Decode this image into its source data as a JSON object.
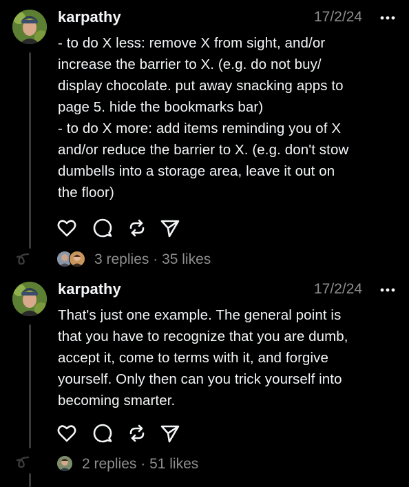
{
  "posts": [
    {
      "username": "karpathy",
      "date": "17/2/24",
      "lines": [
        "- to do X less: remove X from sight, and/or",
        "increase the barrier to X. (e.g. do not buy/",
        "display chocolate. put away snacking apps to",
        "page 5. hide the bookmarks bar)",
        "- to do X more: add items reminding you of X",
        "and/or reduce the barrier to X. (e.g. don't stow",
        "dumbells into a storage area, leave it out on",
        "the floor)"
      ],
      "replies": "3 replies",
      "separator": "·",
      "likes": "35 likes"
    },
    {
      "username": "karpathy",
      "date": "17/2/24",
      "lines": [
        "That's just one example. The general point is",
        "that you have to recognize that you are dumb,",
        "accept it, come to terms with it, and forgive",
        "yourself. Only then can you trick yourself into",
        "becoming smarter."
      ],
      "replies": "2 replies",
      "separator": "·",
      "likes": "51 likes"
    }
  ],
  "icons": [
    "heart-icon",
    "comment-icon",
    "repost-icon",
    "share-icon",
    "more-icon",
    "thread-connector-icon"
  ],
  "colors": {
    "background": "#000000",
    "text": "#f3f5f7",
    "secondary": "#8e8e8e",
    "thread_line": "#3a3a3a"
  }
}
